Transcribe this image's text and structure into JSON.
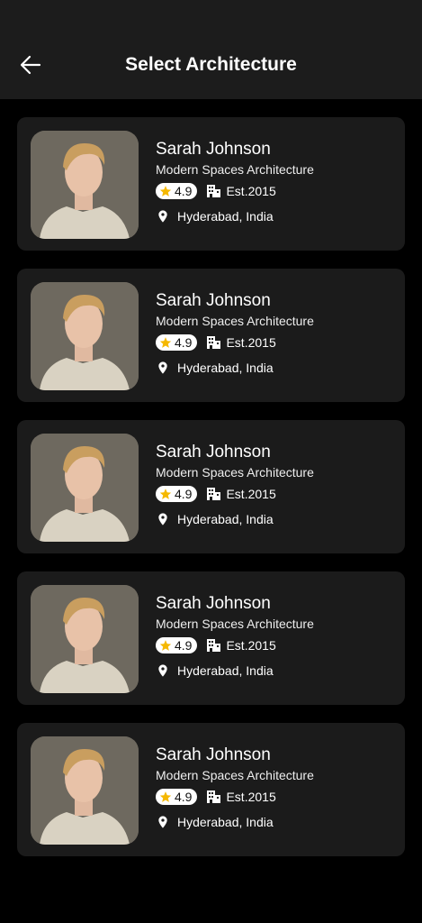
{
  "header": {
    "title": "Select Architecture"
  },
  "colors": {
    "star": "#f5b800",
    "card": "#1b1b1b",
    "header": "#1c1c1c"
  },
  "architects": [
    {
      "name": "Sarah Johnson",
      "firm": "Modern Spaces Architecture",
      "rating": "4.9",
      "established": "Est.2015",
      "location": "Hyderabad, India"
    },
    {
      "name": "Sarah Johnson",
      "firm": "Modern Spaces Architecture",
      "rating": "4.9",
      "established": "Est.2015",
      "location": "Hyderabad, India"
    },
    {
      "name": "Sarah Johnson",
      "firm": "Modern Spaces Architecture",
      "rating": "4.9",
      "established": "Est.2015",
      "location": "Hyderabad, India"
    },
    {
      "name": "Sarah Johnson",
      "firm": "Modern Spaces Architecture",
      "rating": "4.9",
      "established": "Est.2015",
      "location": "Hyderabad, India"
    },
    {
      "name": "Sarah Johnson",
      "firm": "Modern Spaces Architecture",
      "rating": "4.9",
      "established": "Est.2015",
      "location": "Hyderabad, India"
    }
  ]
}
